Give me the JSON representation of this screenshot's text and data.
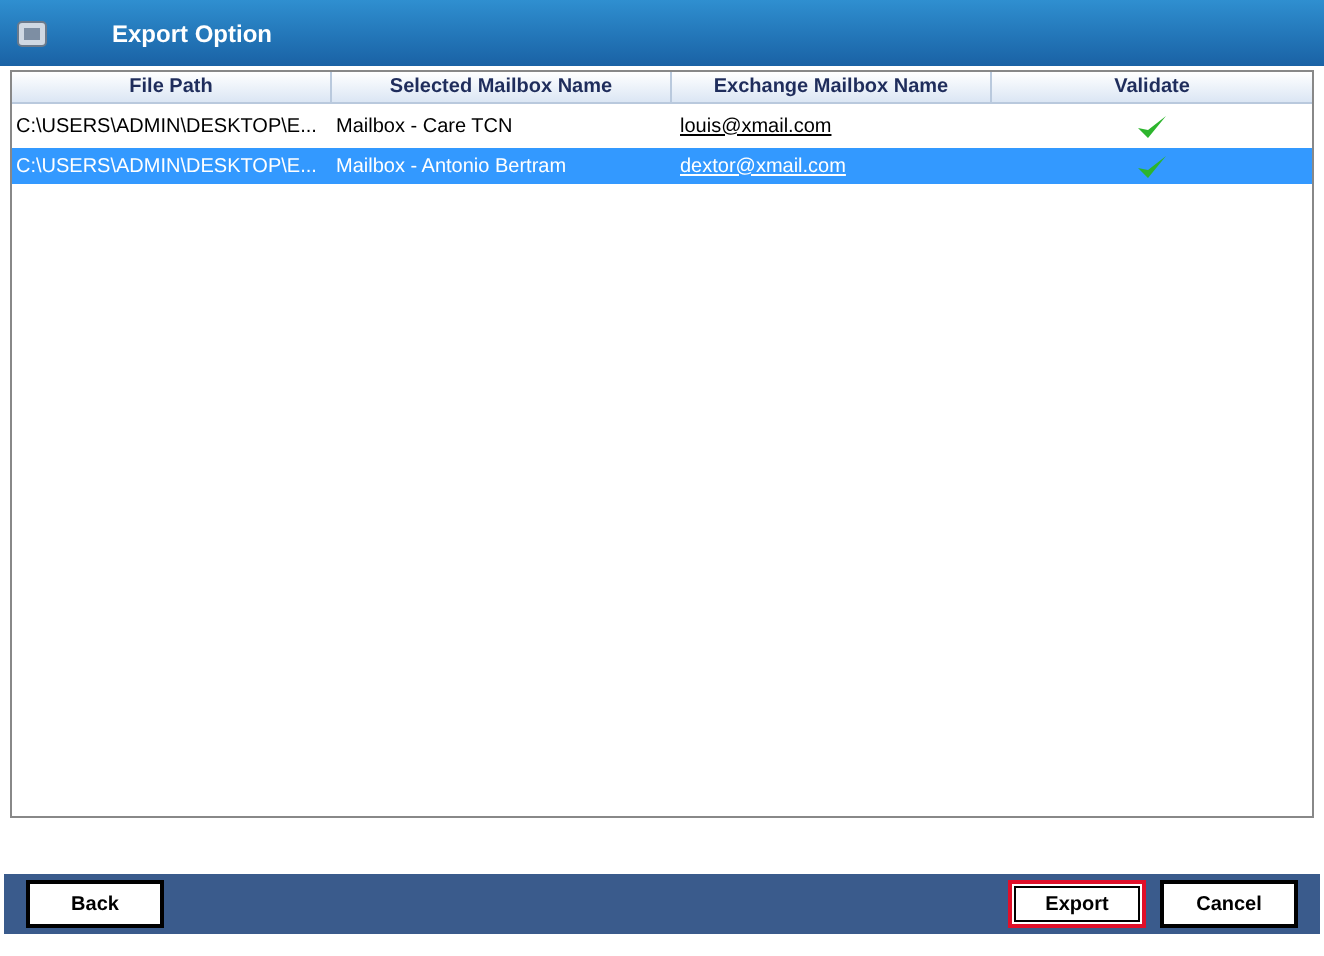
{
  "window": {
    "title": "Export Option"
  },
  "table": {
    "columns": [
      "File Path",
      "Selected Mailbox Name",
      "Exchange Mailbox Name",
      "Validate"
    ],
    "rows": [
      {
        "file_path": "C:\\USERS\\ADMIN\\DESKTOP\\E...",
        "mailbox": "Mailbox - Care TCN",
        "exchange": "louis@xmail.com",
        "valid": true,
        "selected": false
      },
      {
        "file_path": "C:\\USERS\\ADMIN\\DESKTOP\\E...",
        "mailbox": "Mailbox - Antonio Bertram",
        "exchange": "dextor@xmail.com",
        "valid": true,
        "selected": true
      }
    ]
  },
  "footer": {
    "left_buttons": [
      {
        "label": "Back",
        "focused": false
      }
    ],
    "right_buttons": [
      {
        "label": "Export",
        "focused": true
      },
      {
        "label": "Cancel",
        "focused": false
      }
    ]
  }
}
